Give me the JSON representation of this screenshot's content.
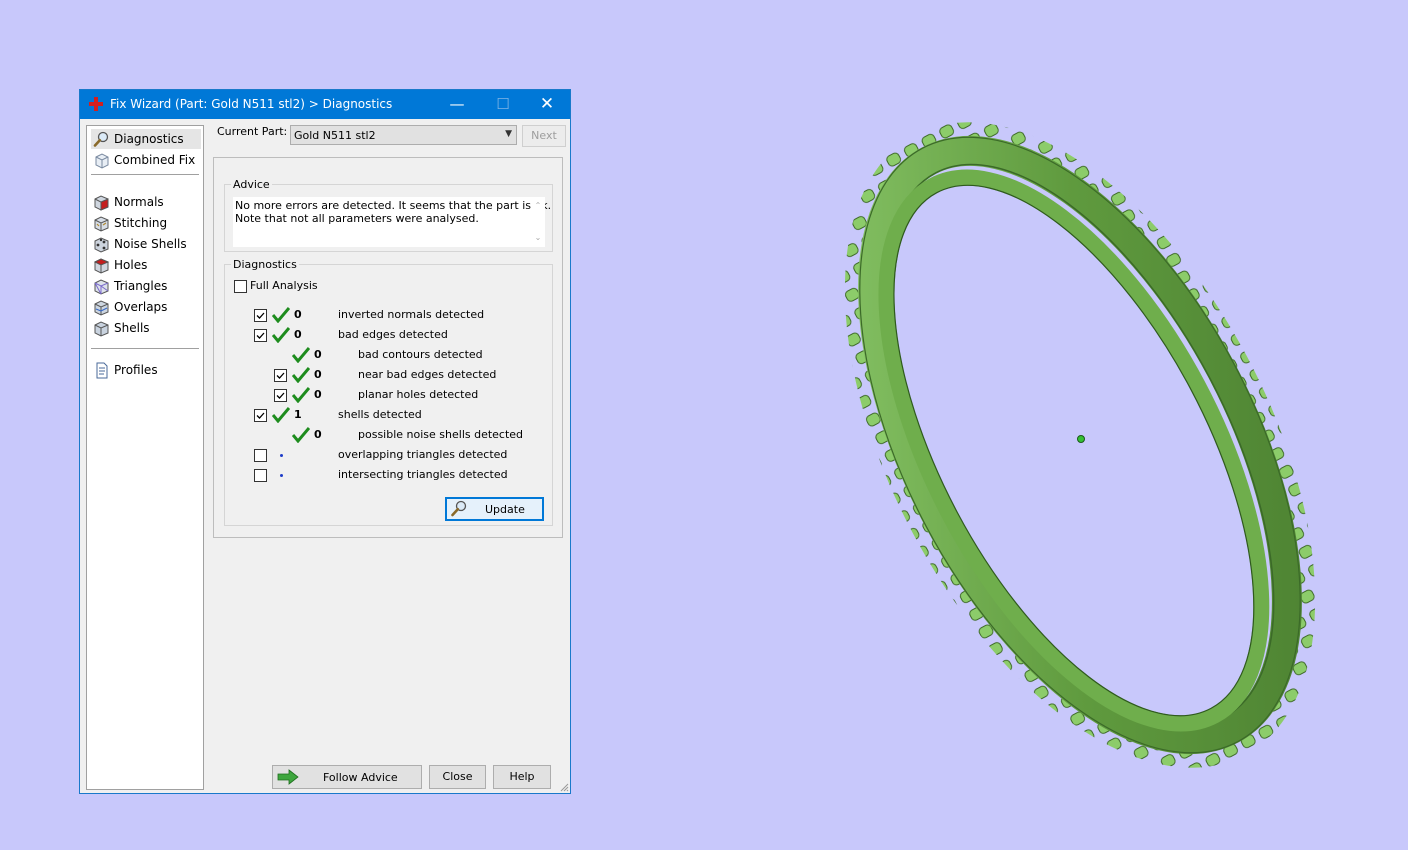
{
  "window": {
    "title": "Fix Wizard (Part: Gold N511 stl2) > Diagnostics",
    "controls": {
      "minimize": "—",
      "maximize": "☐",
      "close": "✕"
    }
  },
  "sidebar": {
    "items": [
      {
        "label": "Diagnostics",
        "icon": "magnifier-icon",
        "selected": true
      },
      {
        "label": "Combined Fix",
        "icon": "cube-outline-icon"
      },
      {
        "label": "Normals",
        "icon": "normals-cube-icon"
      },
      {
        "label": "Stitching",
        "icon": "stitching-cube-icon"
      },
      {
        "label": "Noise Shells",
        "icon": "noise-shells-icon"
      },
      {
        "label": "Holes",
        "icon": "holes-cube-icon"
      },
      {
        "label": "Triangles",
        "icon": "triangles-cube-icon"
      },
      {
        "label": "Overlaps",
        "icon": "overlaps-cube-icon"
      },
      {
        "label": "Shells",
        "icon": "shells-cube-icon"
      },
      {
        "label": "Profiles",
        "icon": "profile-document-icon"
      }
    ]
  },
  "header": {
    "current_part_label": "Current Part:",
    "current_part_value": "Gold N511 stl2",
    "next_label": "Next"
  },
  "advice": {
    "title": "Advice",
    "line1": "No more errors are detected. It seems that the part is ok.",
    "line2": "Note that not all parameters were analysed."
  },
  "diagnostics": {
    "title": "Diagnostics",
    "full_analysis_label": "Full Analysis",
    "full_analysis_checked": false,
    "rows": [
      {
        "checkbox": true,
        "checked": true,
        "status": "ok",
        "count": "0",
        "label": "inverted normals detected",
        "indent": false
      },
      {
        "checkbox": true,
        "checked": true,
        "status": "ok",
        "count": "0",
        "label": "bad edges detected",
        "indent": false
      },
      {
        "checkbox": false,
        "checked": false,
        "status": "ok",
        "count": "0",
        "label": "bad contours detected",
        "indent": true
      },
      {
        "checkbox": true,
        "checked": true,
        "status": "ok",
        "count": "0",
        "label": "near bad edges detected",
        "indent": true
      },
      {
        "checkbox": true,
        "checked": true,
        "status": "ok",
        "count": "0",
        "label": "planar holes detected",
        "indent": true
      },
      {
        "checkbox": true,
        "checked": true,
        "status": "ok",
        "count": "1",
        "label": "shells detected",
        "indent": false
      },
      {
        "checkbox": false,
        "checked": false,
        "status": "ok",
        "count": "0",
        "label": "possible noise shells detected",
        "indent": true
      },
      {
        "checkbox": true,
        "checked": false,
        "status": "pending",
        "count": "",
        "label": "overlapping triangles detected",
        "indent": false
      },
      {
        "checkbox": true,
        "checked": false,
        "status": "pending",
        "count": "",
        "label": "intersecting triangles detected",
        "indent": false
      }
    ],
    "update_label": "Update"
  },
  "footer": {
    "follow_advice_label": "Follow Advice",
    "close_label": "Close",
    "help_label": "Help"
  },
  "colors": {
    "background": "#c8c8fb",
    "titlebar": "#0078d7",
    "check_green": "#1e8c1e",
    "ring_green": "#6aa040"
  },
  "viewport": {
    "object": "green ring with beaded rim (3D model)"
  }
}
